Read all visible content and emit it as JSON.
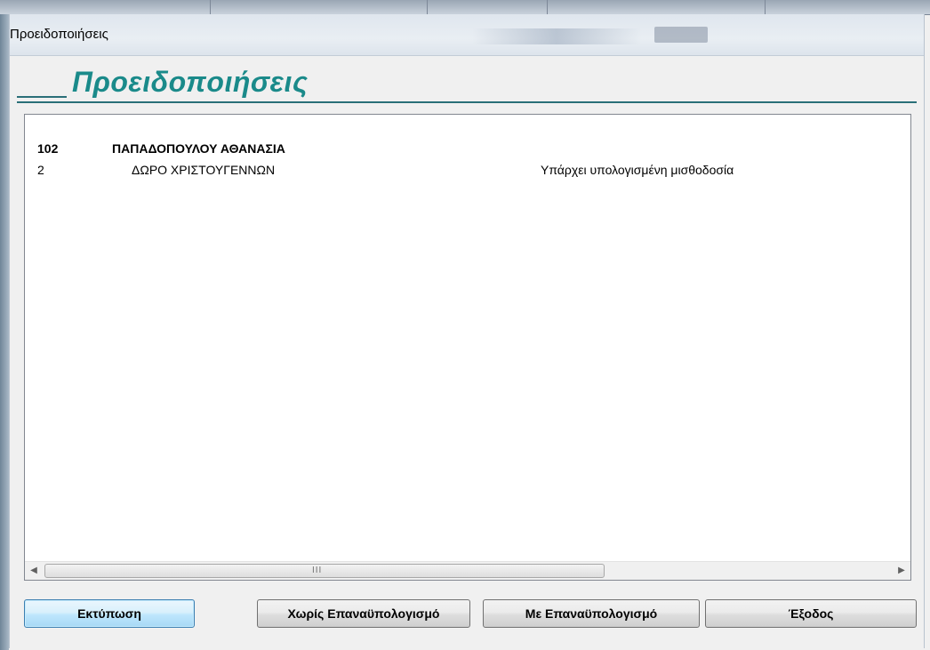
{
  "window": {
    "title": "Προειδοποιήσεις"
  },
  "heading": "Προειδοποιήσεις",
  "list": {
    "rows": [
      {
        "code": "102",
        "name": "ΠΑΠΑΔΟΠΟΥΛΟΥ ΑΘΑΝΑΣΙΑ",
        "message": ""
      },
      {
        "code": "2",
        "name": "ΔΩΡΟ ΧΡΙΣΤΟΥΓΕΝΝΩΝ",
        "message": "Υπάρχει υπολογισμένη μισθοδοσία"
      }
    ],
    "scrollbar_grip": "III"
  },
  "buttons": {
    "print": "Εκτύπωση",
    "without_recalc": "Χωρίς Επαναϋπολογισμό",
    "with_recalc": "Με Επαναϋπολογισμό",
    "exit": "Έξοδος"
  },
  "colors": {
    "heading": "#1a8a8a",
    "heading_line": "#2a6f78",
    "default_button": "#bee6fd"
  },
  "icons": {
    "scroll_left": "◀",
    "scroll_right": "▶"
  }
}
